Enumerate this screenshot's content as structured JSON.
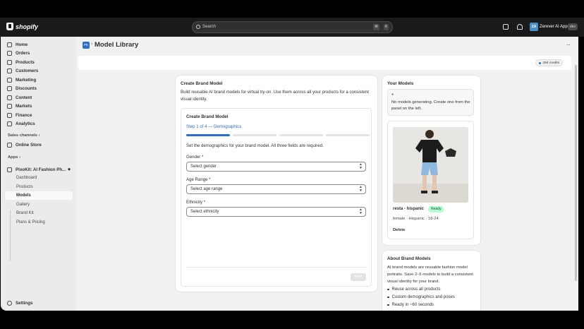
{
  "topbar": {
    "brand": "shopify",
    "search_placeholder": "Search",
    "shortcut_cmd": "⌘",
    "shortcut_key": "K",
    "app_avatar": "ZA",
    "app_name": "Zerever AI App",
    "env_badge": "dev"
  },
  "sidebar": {
    "items": [
      {
        "label": "Home",
        "icon": "home-icon"
      },
      {
        "label": "Orders",
        "icon": "orders-icon"
      },
      {
        "label": "Products",
        "icon": "tag-icon"
      },
      {
        "label": "Customers",
        "icon": "person-icon"
      },
      {
        "label": "Marketing",
        "icon": "target-icon"
      },
      {
        "label": "Discounts",
        "icon": "discount-icon"
      },
      {
        "label": "Content",
        "icon": "content-icon"
      },
      {
        "label": "Markets",
        "icon": "globe-icon"
      },
      {
        "label": "Finance",
        "icon": "bank-icon"
      },
      {
        "label": "Analytics",
        "icon": "chart-icon"
      }
    ],
    "sales_channels_label": "Sales channels",
    "online_store": "Online Store",
    "apps_label": "Apps",
    "app_title": "PixoKit: AI Fashion Ph...",
    "app_pages": [
      "Dashboard",
      "Products",
      "Models",
      "Gallery",
      "Brand Kit",
      "Plans & Pricing"
    ],
    "active_page": "Models",
    "settings": "Settings"
  },
  "header": {
    "app_badge": "PK",
    "separator": "›",
    "title": "Model Library",
    "credits": "284 credits"
  },
  "create_card": {
    "title": "Create Brand Model",
    "description": "Build reusable AI brand models for virtual try-on. Use them across all your products for a consistent visual identity.",
    "form_title": "Create Brand Model",
    "step_text": "Step 1 of 4 — Demographics",
    "step_current": 1,
    "step_total": 4,
    "instructions": "Set the demographics for your brand model. All three fields are required.",
    "gender_label": "Gender *",
    "gender_value": "Select gender",
    "age_label": "Age Range *",
    "age_value": "Select age range",
    "ethnicity_label": "Ethnicity *",
    "ethnicity_value": "Select ethnicity",
    "next_button": "Next"
  },
  "models_card": {
    "title": "Your Models",
    "notice": "No models generating. Create one from the panel on the left.",
    "model": {
      "name": "resta - hispanic",
      "status": "Ready",
      "details": "female · Hispanic · 18-24",
      "delete_label": "Delete"
    }
  },
  "about_card": {
    "title": "About Brand Models",
    "description": "AI brand models are reusable fashion model portraits. Save 2–5 models to build a consistent visual identity for your brand.",
    "bullets": [
      "Reuse across all products",
      "Custom demographics and poses",
      "Ready in ~60 seconds"
    ]
  },
  "colors": {
    "accent": "#2c6ecb",
    "topbar": "#1a1a1a",
    "ready_bg": "#b4fed2"
  }
}
